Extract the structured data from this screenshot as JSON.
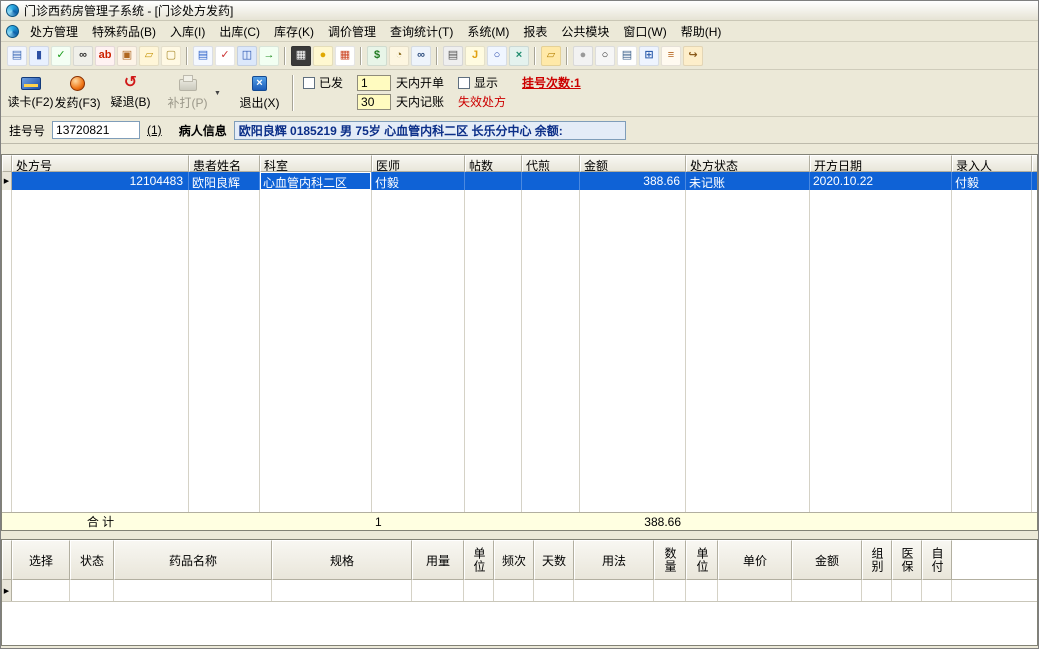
{
  "window": {
    "title": "门诊西药房管理子系统 - [门诊处方发药]"
  },
  "menu": {
    "items": [
      "处方管理",
      "特殊药品(B)",
      "入库(I)",
      "出库(C)",
      "库存(K)",
      "调价管理",
      "查询统计(T)",
      "系统(M)",
      "报表",
      "公共模块",
      "窗口(W)",
      "帮助(H)"
    ]
  },
  "toolbar": {
    "icons": [
      {
        "name": "toolbar-icon-preview",
        "glyph": "▤",
        "bg": "#f2f6ff",
        "fg": "#3b68b5"
      },
      {
        "name": "toolbar-icon-vial",
        "glyph": "▮",
        "bg": "#e8f0ff",
        "fg": "#2c4fa3"
      },
      {
        "name": "toolbar-icon-confirm",
        "glyph": "✓",
        "bg": "#f4fff4",
        "fg": "#1a9c1a"
      },
      {
        "name": "toolbar-icon-binoculars",
        "glyph": "∞",
        "bg": "#f0f0ea",
        "fg": "#333333"
      },
      {
        "name": "toolbar-icon-audit",
        "glyph": "ab",
        "bg": "#fff2f2",
        "fg": "#cc2200"
      },
      {
        "name": "toolbar-icon-stamp",
        "glyph": "▣",
        "bg": "#fdf4e8",
        "fg": "#b06820"
      },
      {
        "name": "toolbar-icon-folder-out",
        "glyph": "▱",
        "bg": "#fff6d8",
        "fg": "#c79810"
      },
      {
        "name": "toolbar-icon-archive",
        "glyph": "▢",
        "bg": "#fff9e4",
        "fg": "#a98a2a"
      },
      {
        "sep": true
      },
      {
        "name": "toolbar-icon-new-doc",
        "glyph": "▤",
        "bg": "#f4f8ff",
        "fg": "#2e62c9"
      },
      {
        "name": "toolbar-icon-doc-check",
        "glyph": "✓",
        "bg": "#ffffff",
        "fg": "#cc3333"
      },
      {
        "name": "toolbar-icon-save",
        "glyph": "◫",
        "bg": "#dce8fb",
        "fg": "#2955b0"
      },
      {
        "name": "toolbar-icon-doc-export",
        "glyph": "→",
        "bg": "#f2fff2",
        "fg": "#1f8c1f"
      },
      {
        "sep": true
      },
      {
        "name": "toolbar-icon-keypad",
        "glyph": "▦",
        "bg": "#3a3a3a",
        "fg": "#ffffff"
      },
      {
        "name": "toolbar-icon-alarm",
        "glyph": "●",
        "bg": "#fff8d0",
        "fg": "#e0a800"
      },
      {
        "name": "toolbar-icon-calendar",
        "glyph": "▦",
        "bg": "#ffffff",
        "fg": "#cc4422"
      },
      {
        "sep": true
      },
      {
        "name": "toolbar-icon-cash",
        "glyph": "$",
        "bg": "#e8f5e8",
        "fg": "#1f7a1f"
      },
      {
        "name": "toolbar-icon-folder-find",
        "glyph": "◔",
        "bg": "#fdf6e0",
        "fg": "#8a6d1f"
      },
      {
        "name": "toolbar-icon-lookup",
        "glyph": "∞",
        "bg": "#eef4fb",
        "fg": "#2f4f7f"
      },
      {
        "sep": true
      },
      {
        "name": "toolbar-icon-print",
        "glyph": "▤",
        "bg": "#efefef",
        "fg": "#555555"
      },
      {
        "name": "toolbar-icon-key",
        "glyph": "J",
        "bg": "#fffbe0",
        "fg": "#e0a010"
      },
      {
        "name": "toolbar-icon-zoom",
        "glyph": "○",
        "bg": "#f0f6ff",
        "fg": "#2244aa"
      },
      {
        "name": "toolbar-icon-close-box",
        "glyph": "×",
        "bg": "#e4f2ee",
        "fg": "#1f8c6e"
      },
      {
        "sep": true
      },
      {
        "name": "toolbar-icon-open-folder",
        "glyph": "▱",
        "bg": "#ffe9a8",
        "fg": "#b8860b"
      },
      {
        "sep": true
      },
      {
        "name": "toolbar-icon-sphere",
        "glyph": "●",
        "bg": "#f2f2f2",
        "fg": "#9a9a9a"
      },
      {
        "name": "toolbar-icon-search",
        "glyph": "○",
        "bg": "#f6f6f6",
        "fg": "#222222"
      },
      {
        "name": "toolbar-icon-report",
        "glyph": "▤",
        "bg": "#ffffff",
        "fg": "#3a5f8a"
      },
      {
        "name": "toolbar-icon-grid-view",
        "glyph": "⊞",
        "bg": "#eef4ff",
        "fg": "#2f5fae"
      },
      {
        "name": "toolbar-icon-edit-doc",
        "glyph": "≡",
        "bg": "#fffaf0",
        "fg": "#b5651d"
      },
      {
        "name": "toolbar-icon-exit-door",
        "glyph": "↪",
        "bg": "#fdeeca",
        "fg": "#8a5a1a"
      }
    ]
  },
  "actions": {
    "read_card": "读卡(F2)",
    "dispense": "发药(F3)",
    "suspect_return": "疑退(B)",
    "reprint": "补打(P)",
    "exit": "退出(X)",
    "sent_label": "已发",
    "days_open_value": "1",
    "days_open_label": "天内开单",
    "days_account_value": "30",
    "days_account_label": "天内记账",
    "show_label": "显示",
    "expired_label": "失效处方",
    "visit_count_label": "挂号次数:1"
  },
  "patient": {
    "reg_no_label": "挂号号",
    "reg_no_value": "13720821",
    "reg_count": "(1)",
    "info_label": "病人信息",
    "info_value": "欧阳良辉  0185219  男    75岁  心血管内科二区  长乐分中心  余额:"
  },
  "rx_table": {
    "columns": [
      "处方号",
      "患者姓名",
      "科室",
      "医师",
      "帖数",
      "代煎",
      "金额",
      "处方状态",
      "开方日期",
      "录入人"
    ],
    "row": {
      "rx_no": "12104483",
      "patient_name": "欧阳良辉",
      "department": "心血管内科二区",
      "doctor": "付毅",
      "packs": "",
      "decoct": "",
      "amount": "388.66",
      "status": "未记账",
      "date": "2020.10.22",
      "entered_by": "付毅"
    },
    "summary": {
      "label": "合  计",
      "count": "1",
      "amount": "388.66"
    }
  },
  "detail_table": {
    "columns": [
      "选择",
      "状态",
      "药品名称",
      "规格",
      "用量",
      "单位",
      "频次",
      "天数",
      "用法",
      "数量",
      "单位",
      "单价",
      "金额",
      "组别",
      "医保",
      "自付"
    ]
  },
  "colors": {
    "selection_blue": "#0f62d6",
    "summary_yellow": "#ffffe1",
    "alert_red": "#cc0000",
    "field_yellow": "#fffbc0",
    "info_text_navy": "#0b2e88",
    "info_bg": "#e4ecf7"
  }
}
